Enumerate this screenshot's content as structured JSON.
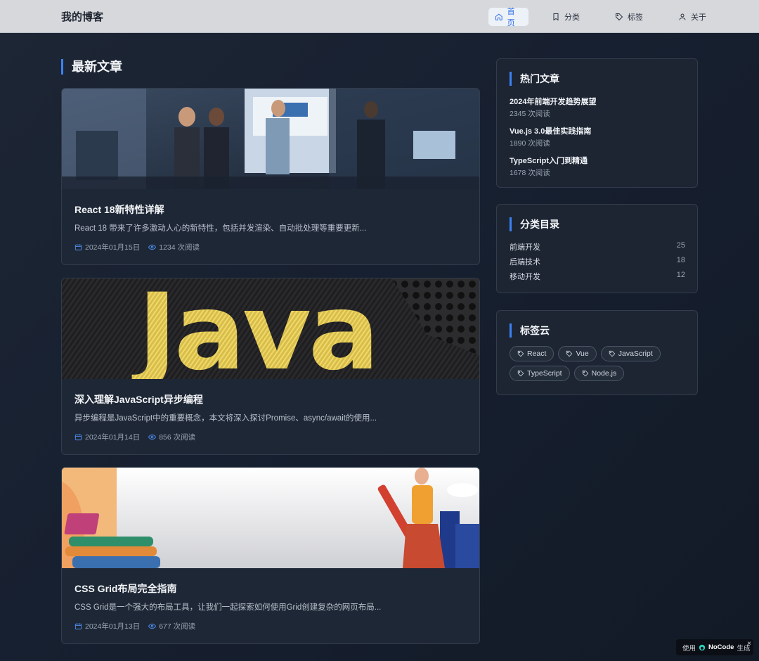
{
  "header": {
    "brand": "我的博客",
    "nav": [
      {
        "label": "首页",
        "icon": "home-icon",
        "active": true
      },
      {
        "label": "分类",
        "icon": "bookmark-icon",
        "active": false
      },
      {
        "label": "标签",
        "icon": "tag-icon",
        "active": false
      },
      {
        "label": "关于",
        "icon": "user-icon",
        "active": false
      }
    ]
  },
  "main": {
    "section_title": "最新文章",
    "posts": [
      {
        "title": "React 18新特性详解",
        "excerpt": "React 18 带来了许多激动人心的新特性，包括并发渲染、自动批处理等重要更新...",
        "date": "2024年01月15日",
        "views": "1234 次阅读"
      },
      {
        "title": "深入理解JavaScript异步编程",
        "excerpt": "异步编程是JavaScript中的重要概念，本文将深入探讨Promise、async/await的使用...",
        "date": "2024年01月14日",
        "views": "856 次阅读",
        "image_text": "Java"
      },
      {
        "title": "CSS Grid布局完全指南",
        "excerpt": "CSS Grid是一个强大的布局工具，让我们一起探索如何使用Grid创建复杂的网页布局...",
        "date": "2024年01月13日",
        "views": "677 次阅读"
      }
    ]
  },
  "sidebar": {
    "hot": {
      "title": "热门文章",
      "items": [
        {
          "title": "2024年前端开发趋势展望",
          "views": "2345 次阅读"
        },
        {
          "title": "Vue.js 3.0最佳实践指南",
          "views": "1890 次阅读"
        },
        {
          "title": "TypeScript入门到精通",
          "views": "1678 次阅读"
        }
      ]
    },
    "categories": {
      "title": "分类目录",
      "items": [
        {
          "name": "前端开发",
          "count": "25"
        },
        {
          "name": "后端技术",
          "count": "18"
        },
        {
          "name": "移动开发",
          "count": "12"
        }
      ]
    },
    "tags": {
      "title": "标签云",
      "items": [
        "React",
        "Vue",
        "JavaScript",
        "TypeScript",
        "Node.js"
      ]
    }
  },
  "badge": {
    "prefix": "使用",
    "brand": "NoCode",
    "suffix": "生成",
    "close": "×"
  },
  "colors": {
    "accent": "#3b82f6",
    "header_bg": "#d6d8dc",
    "page_bg": "#172030",
    "card_bg": "#1e2735"
  }
}
